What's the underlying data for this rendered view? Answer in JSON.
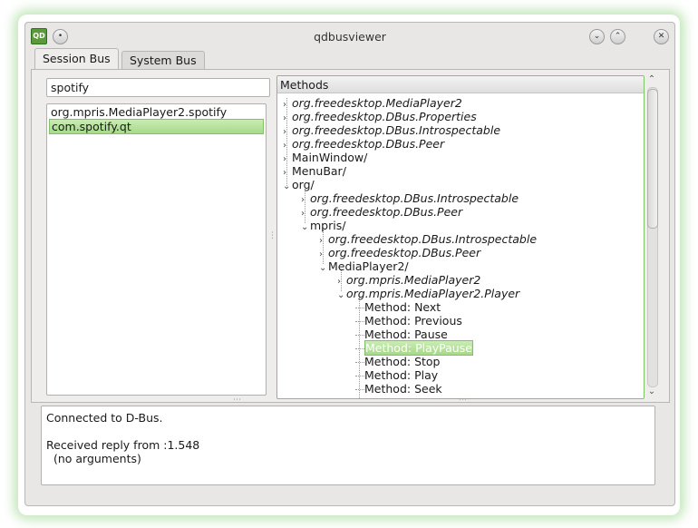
{
  "window": {
    "title": "qdbusviewer"
  },
  "tabs": [
    {
      "label": "Session Bus",
      "active": true
    },
    {
      "label": "System Bus",
      "active": false
    }
  ],
  "search": {
    "value": "spotify"
  },
  "services": [
    {
      "label": "org.mpris.MediaPlayer2.spotify",
      "selected": false
    },
    {
      "label": "com.spotify.qt",
      "selected": true
    }
  ],
  "methods": {
    "header": "Methods",
    "rows": [
      {
        "label": "org.freedesktop.MediaPlayer2",
        "twisty": "›",
        "italic": true
      },
      {
        "label": "org.freedesktop.DBus.Properties",
        "twisty": "›",
        "italic": true
      },
      {
        "label": "org.freedesktop.DBus.Introspectable",
        "twisty": "›",
        "italic": true
      },
      {
        "label": "org.freedesktop.DBus.Peer",
        "twisty": "›",
        "italic": true
      },
      {
        "label": "MainWindow/",
        "twisty": "›",
        "italic": false
      },
      {
        "label": "MenuBar/",
        "twisty": "›",
        "italic": false
      },
      {
        "label": "org/",
        "twisty": "⌄",
        "italic": false
      },
      {
        "label": "org.freedesktop.DBus.Introspectable",
        "twisty": "›",
        "italic": true
      },
      {
        "label": "org.freedesktop.DBus.Peer",
        "twisty": "›",
        "italic": true
      },
      {
        "label": "mpris/",
        "twisty": "⌄",
        "italic": false
      },
      {
        "label": "org.freedesktop.DBus.Introspectable",
        "twisty": "›",
        "italic": true
      },
      {
        "label": "org.freedesktop.DBus.Peer",
        "twisty": "›",
        "italic": true
      },
      {
        "label": "MediaPlayer2/",
        "twisty": "⌄",
        "italic": false
      },
      {
        "label": "org.mpris.MediaPlayer2",
        "twisty": "›",
        "italic": true
      },
      {
        "label": "org.mpris.MediaPlayer2.Player",
        "twisty": "⌄",
        "italic": true
      },
      {
        "label": "Method: Next",
        "twisty": "",
        "italic": false
      },
      {
        "label": "Method: Previous",
        "twisty": "",
        "italic": false
      },
      {
        "label": "Method: Pause",
        "twisty": "",
        "italic": false
      },
      {
        "label": "Method: PlayPause",
        "twisty": "",
        "italic": false,
        "selected": true
      },
      {
        "label": "Method: Stop",
        "twisty": "",
        "italic": false
      },
      {
        "label": "Method: Play",
        "twisty": "",
        "italic": false
      },
      {
        "label": "Method: Seek",
        "twisty": "",
        "italic": false
      }
    ]
  },
  "output": {
    "lines": [
      "Connected to D-Bus.",
      "",
      "Received reply from :1.548",
      "  (no arguments)"
    ]
  },
  "icons": {
    "app": "qdbusviewer-app-icon",
    "menu": "window-menu-icon",
    "minimize": "minimize-icon",
    "maximize": "maximize-icon",
    "close": "close-icon",
    "scroll_up": "scroll-up-icon",
    "scroll_down": "scroll-down-icon"
  },
  "colors": {
    "selection": "#a7d98a",
    "focus_border": "#7fc46a",
    "glow": "#78c864"
  }
}
